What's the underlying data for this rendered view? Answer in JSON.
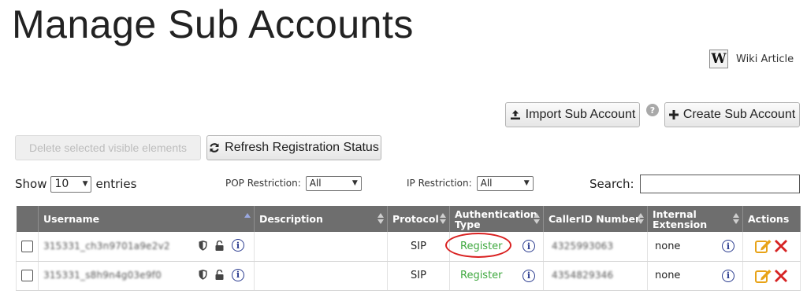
{
  "page": {
    "title": "Manage Sub Accounts",
    "wiki_logo_letter": "W",
    "wiki_label": "Wiki Article"
  },
  "toolbar": {
    "import_label": "Import Sub Account",
    "help_symbol": "?",
    "create_label": "Create Sub Account",
    "delete_label": "Delete selected visible elements",
    "refresh_label": "Refresh Registration Status"
  },
  "controls": {
    "show_label": "Show",
    "entries_value": "10",
    "entries_label": "entries",
    "pop_label": "POP Restriction:",
    "pop_value": "All",
    "ip_label": "IP Restriction:",
    "ip_value": "All",
    "search_label": "Search:",
    "search_value": ""
  },
  "table": {
    "columns": [
      "",
      "Username",
      "Description",
      "Protocol",
      "Authentication Type",
      "CallerID Number",
      "Internal Extension",
      "Actions"
    ],
    "rows": [
      {
        "username": "315331_ch3n9701a9e2v2",
        "description": "",
        "protocol": "SIP",
        "auth": "Register",
        "callerid": "4325993063",
        "extension": "none"
      },
      {
        "username": "315331_s8h9n4g03e9f0",
        "description": "",
        "protocol": "SIP",
        "auth": "Register",
        "callerid": "4354829346",
        "extension": "none"
      }
    ]
  },
  "icons": {
    "upload": "upload-icon",
    "plus": "plus-icon",
    "refresh": "refresh-icon",
    "shield": "shield-icon",
    "lock": "unlock-icon",
    "info": "info-icon",
    "edit": "edit-icon",
    "delete": "delete-icon"
  },
  "colors": {
    "header_bg": "#6e6e6e",
    "register_green": "#3fa83f",
    "info_blue": "#2a3b8f",
    "edit_orange": "#e8a317",
    "delete_red": "#d62222",
    "annotation_red": "#d92020"
  }
}
